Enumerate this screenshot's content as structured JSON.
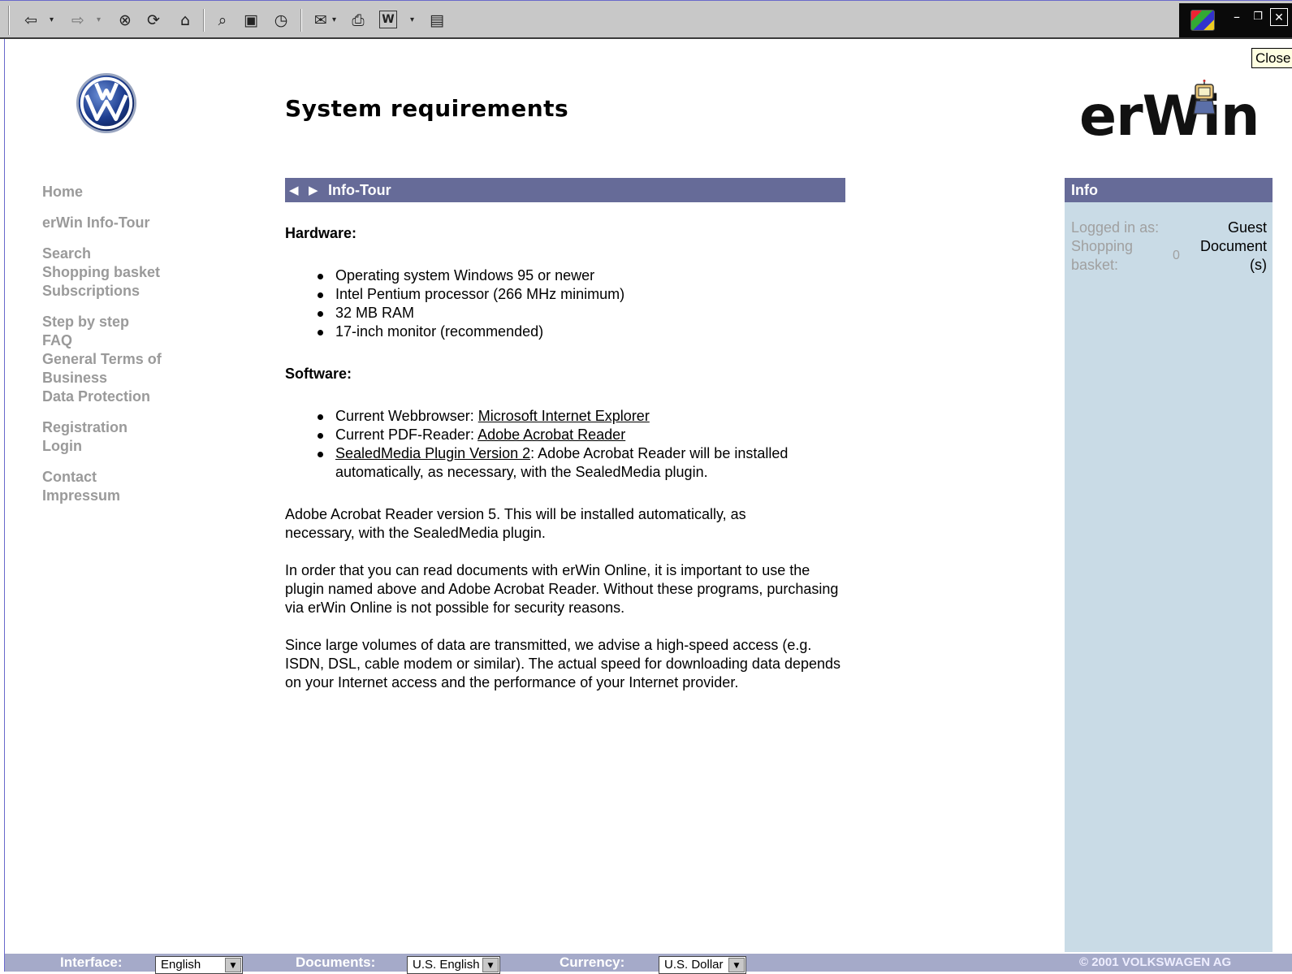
{
  "toolbar": {
    "buttons": [
      {
        "name": "back-icon",
        "glyph": "⇦"
      },
      {
        "name": "forward-icon",
        "glyph": "⇨"
      },
      {
        "name": "stop-icon",
        "glyph": "⊗"
      },
      {
        "name": "refresh-icon",
        "glyph": "⟳"
      },
      {
        "name": "home-icon",
        "glyph": "⌂"
      },
      {
        "name": "search-icon",
        "glyph": "⌕"
      },
      {
        "name": "favorites-icon",
        "glyph": "▣"
      },
      {
        "name": "history-icon",
        "glyph": "◷"
      },
      {
        "name": "mail-icon",
        "glyph": "✉"
      },
      {
        "name": "print-icon",
        "glyph": "⎙"
      },
      {
        "name": "edit-icon",
        "glyph": "W"
      },
      {
        "name": "discuss-icon",
        "glyph": "▤"
      }
    ]
  },
  "window_controls": {
    "minimize": "–",
    "restore": "❐",
    "close": "✕"
  },
  "tooltip": {
    "text": "Close"
  },
  "page": {
    "title": "System requirements"
  },
  "logos": {
    "erwin": "erWin",
    "vw": "VW"
  },
  "nav": {
    "groups": [
      [
        "Home"
      ],
      [
        "erWin Info-Tour"
      ],
      [
        "Search",
        "Shopping basket",
        "Subscriptions"
      ],
      [
        "Step by step",
        "FAQ",
        "General Terms of Business",
        "Data Protection"
      ],
      [
        "Registration",
        "Login"
      ],
      [
        "Contact",
        "Impressum"
      ]
    ]
  },
  "tour_bar": {
    "label": "Info-Tour",
    "prev": "◀",
    "next": "▶"
  },
  "content": {
    "hardware_heading": "Hardware:",
    "hardware_items": [
      "Operating system Windows 95 or newer",
      "Intel Pentium processor (266 MHz minimum)",
      "32 MB RAM",
      "17-inch monitor (recommended)"
    ],
    "software_heading": "Software:",
    "software_items": [
      {
        "prefix": "Current Webbrowser: ",
        "link": "Microsoft Internet Explorer",
        "suffix": ""
      },
      {
        "prefix": "Current PDF-Reader: ",
        "link": "Adobe Acrobat Reader",
        "suffix": ""
      },
      {
        "prefix": "",
        "link": "SealedMedia Plugin Version 2",
        "suffix": ": Adobe Acrobat Reader will be installed automatically, as necessary, with the SealedMedia plugin."
      }
    ],
    "paragraphs": [
      "Adobe Acrobat Reader version 5. This will be installed automatically, as necessary, with the SealedMedia plugin.",
      "In order that you can read documents with erWin Online, it is important to use the plugin named above and Adobe Acrobat Reader. Without these programs, purchasing via erWin Online is not possible for security reasons.",
      "Since large volumes of data are transmitted, we advise a high-speed access (e.g. ISDN, DSL, cable modem or similar). The actual speed for downloading data depends on your Internet access and the performance of your Internet provider."
    ]
  },
  "info": {
    "heading": "Info",
    "logged_in_label": "Logged in as:",
    "logged_in_value": "Guest",
    "basket_label_1": "Shopping",
    "basket_label_2": "basket:",
    "basket_count": "0",
    "basket_unit_1": "Document",
    "basket_unit_2": "(s)"
  },
  "bottom_bar": {
    "interface_label": "Interface:",
    "interface_value": "English",
    "documents_label": "Documents:",
    "documents_value": "U.S. English",
    "currency_label": "Currency:",
    "currency_value": "U.S. Dollar",
    "copyright": "© 2001 VOLKSWAGEN AG"
  }
}
